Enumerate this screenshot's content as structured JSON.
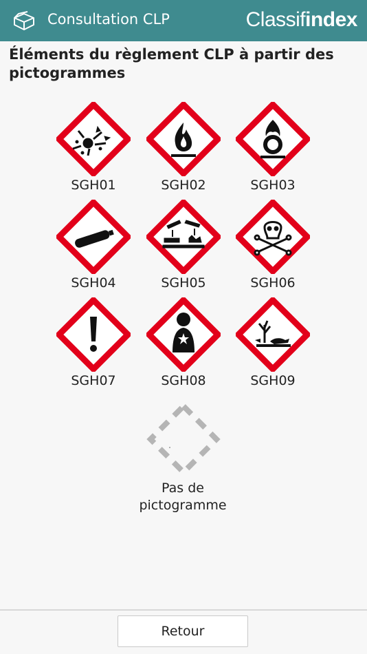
{
  "header": {
    "app_icon": "open-box-icon",
    "title": "Consultation CLP",
    "brand_light": "Classif",
    "brand_bold": "index",
    "background_color": "#3f8b8f"
  },
  "page": {
    "heading": "Éléments du règlement CLP à partir des pictogrammes"
  },
  "pictograms": [
    {
      "code": "SGH01",
      "icon": "exploding-bomb-icon"
    },
    {
      "code": "SGH02",
      "icon": "flame-icon"
    },
    {
      "code": "SGH03",
      "icon": "flame-over-circle-icon"
    },
    {
      "code": "SGH04",
      "icon": "gas-cylinder-icon"
    },
    {
      "code": "SGH05",
      "icon": "corrosion-icon"
    },
    {
      "code": "SGH06",
      "icon": "skull-crossbones-icon"
    },
    {
      "code": "SGH07",
      "icon": "exclamation-mark-icon"
    },
    {
      "code": "SGH08",
      "icon": "health-hazard-icon"
    },
    {
      "code": "SGH09",
      "icon": "environment-icon"
    }
  ],
  "no_pictogram": {
    "line1": "Pas de",
    "line2": "pictogramme"
  },
  "footer": {
    "back_label": "Retour"
  },
  "colors": {
    "hazard_red": "#e2001a",
    "dashed_gray": "#b5b5b5"
  }
}
